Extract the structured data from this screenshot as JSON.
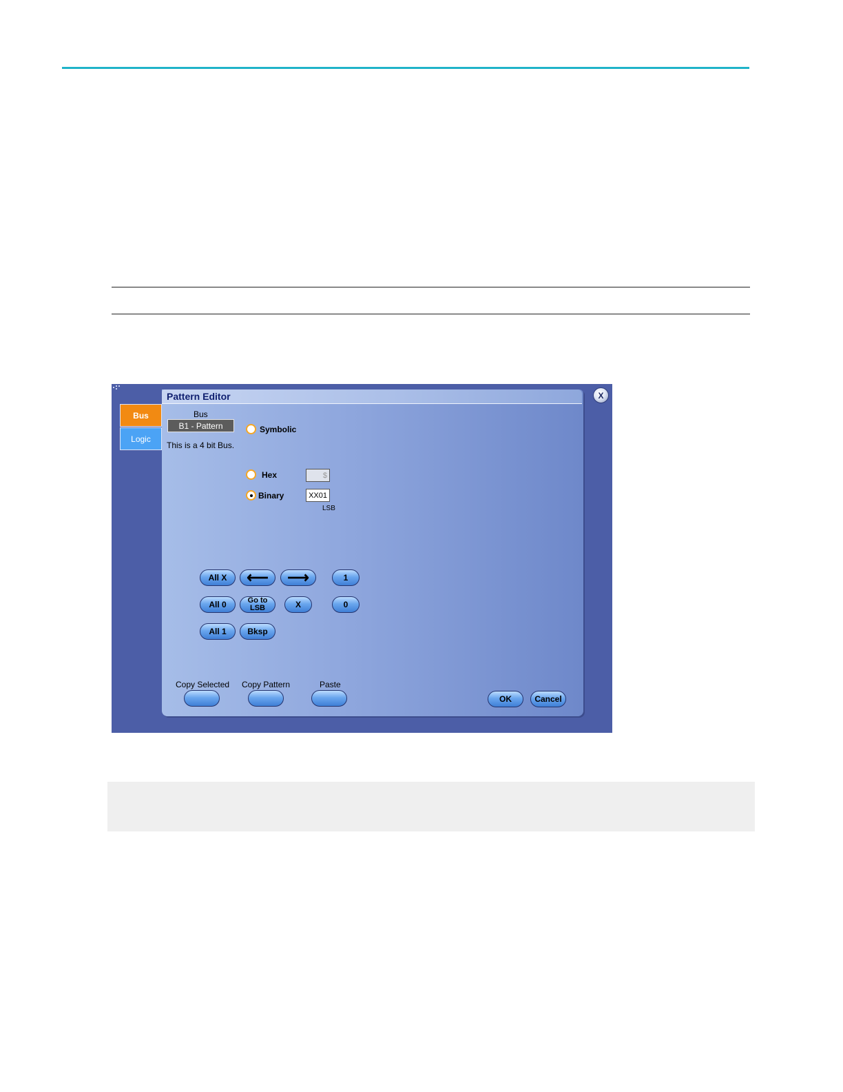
{
  "dialog": {
    "title": "Pattern Editor",
    "close_label": "X",
    "tabs": [
      {
        "label": "Bus",
        "selected": true
      },
      {
        "label": "Logic",
        "selected": false
      }
    ],
    "bus": {
      "label": "Bus",
      "value": "B1 - Pattern",
      "description": "This is a 4 bit Bus."
    },
    "radix": {
      "symbolic_label": "Symbolic",
      "hex_label": "Hex",
      "binary_label": "Binary",
      "selected": "Binary",
      "hex_value": "$",
      "binary_value": "XX01",
      "lsb_label": "LSB"
    },
    "keypad": {
      "all_x": "All X",
      "all_0": "All 0",
      "all_1": "All 1",
      "left_arrow": "⟵",
      "right_arrow": "⟶",
      "go_to_lsb": "Go to LSB",
      "x": "X",
      "bksp": "Bksp",
      "one": "1",
      "zero": "0"
    },
    "clipboard": {
      "copy_selected": "Copy Selected",
      "copy_pattern": "Copy Pattern",
      "paste": "Paste"
    },
    "ok_label": "OK",
    "cancel_label": "Cancel"
  },
  "colors": {
    "accent_rule": "#1fb3c9",
    "tab_bus": "#f28a12",
    "tab_logic": "#4ba3f5",
    "frame": "#4c5ea7",
    "title_text": "#0f1f6f"
  }
}
